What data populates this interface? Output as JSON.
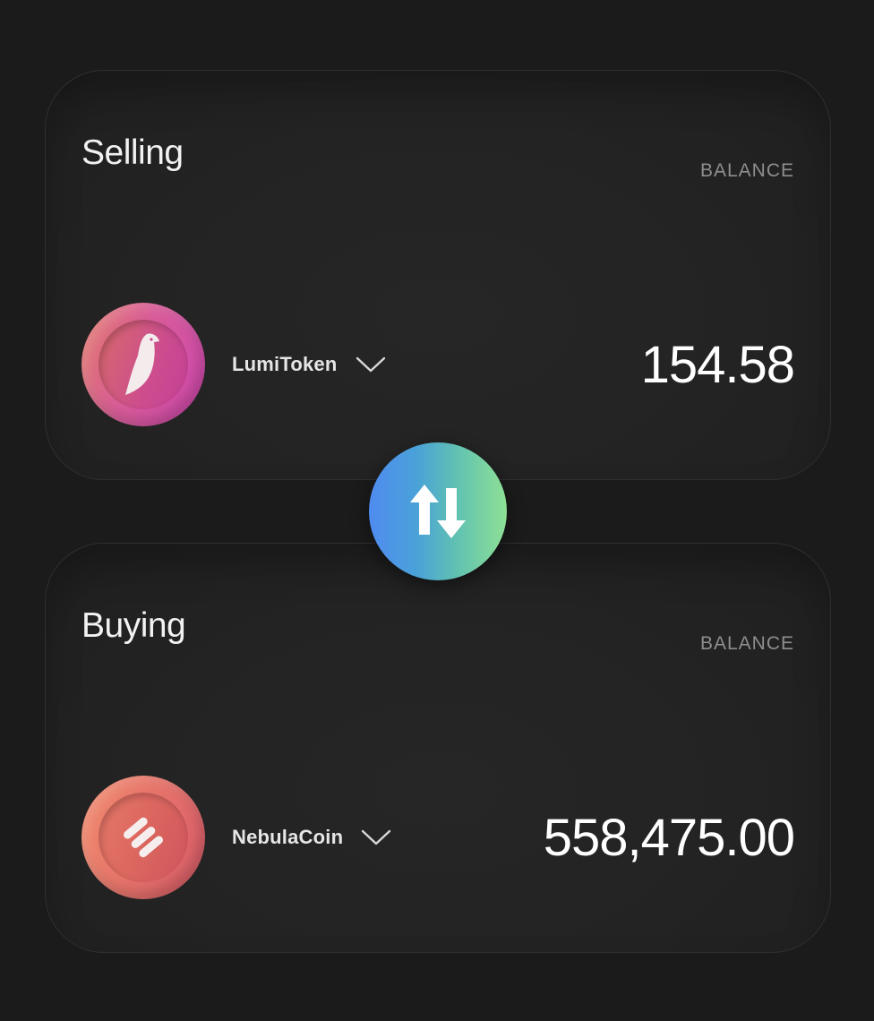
{
  "selling": {
    "title": "Selling",
    "balance_label": "BALANCE",
    "token": {
      "name": "LumiToken",
      "icon": "bird-icon"
    },
    "amount": "154.58"
  },
  "buying": {
    "title": "Buying",
    "balance_label": "BALANCE",
    "token": {
      "name": "NebulaCoin",
      "icon": "stripes-s-icon"
    },
    "amount": "558,475.00"
  },
  "swap": {
    "icon": "swap-arrows-icon"
  },
  "colors": {
    "background": "#1b1b1b",
    "card": "#232323",
    "swap_gradient_start": "#4f8bf0",
    "swap_gradient_end": "#8ee095",
    "lumi_gradient": "#d85c98",
    "nebula_gradient": "#e4706a"
  }
}
